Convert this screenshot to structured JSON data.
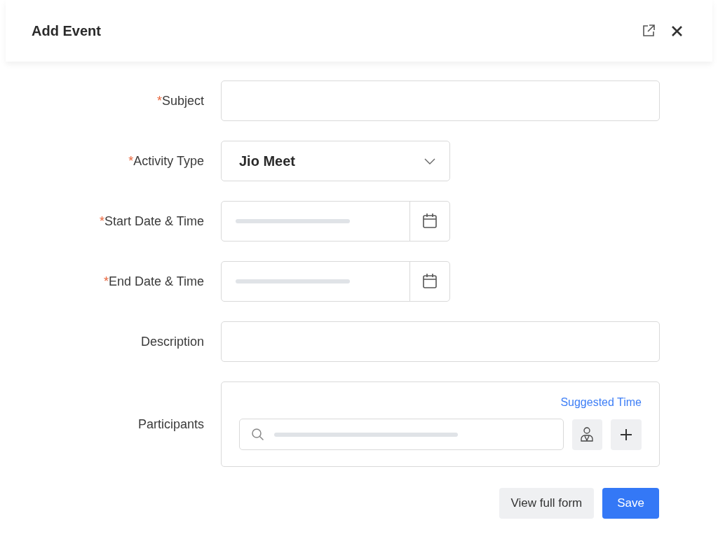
{
  "dialog": {
    "title": "Add Event"
  },
  "fields": [
    {
      "kind": "text",
      "required_mark": "*",
      "label": "Subject"
    },
    {
      "kind": "select",
      "required_mark": "*",
      "label": "Activity Type",
      "value": "Jio Meet"
    },
    {
      "kind": "datetime",
      "required_mark": "*",
      "label": "Start Date & Time"
    },
    {
      "kind": "datetime",
      "required_mark": "*",
      "label": "End Date & Time"
    },
    {
      "kind": "text",
      "label": "Description"
    },
    {
      "kind": "participants",
      "label": "Participants",
      "link": "Suggested Time"
    }
  ],
  "buttons": [
    {
      "label": "View full form",
      "kind": "secondary"
    },
    {
      "label": "Save",
      "kind": "primary"
    }
  ]
}
